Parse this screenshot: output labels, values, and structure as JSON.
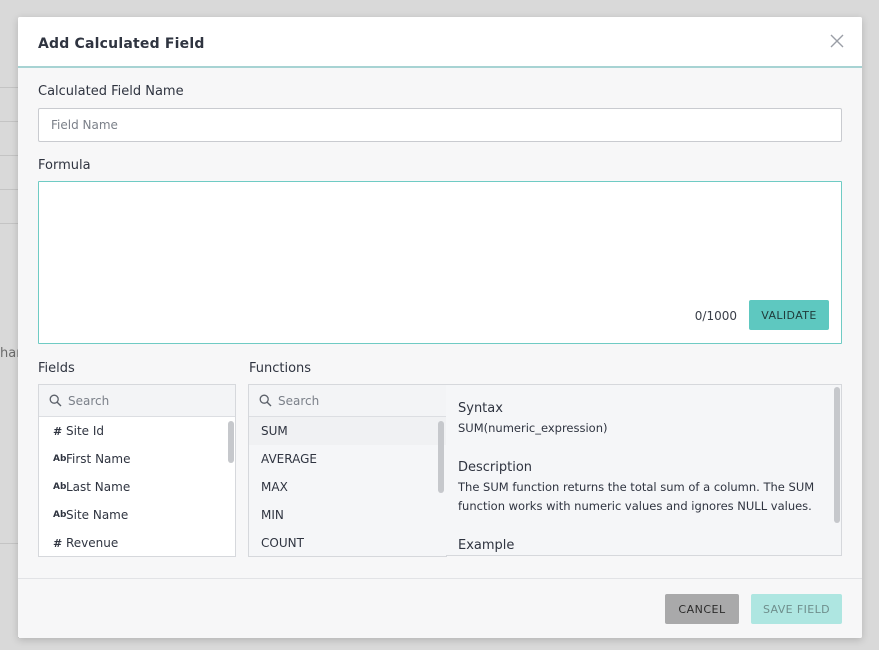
{
  "background": {
    "partial_text": "har"
  },
  "dialog": {
    "title": "Add Calculated Field",
    "close_icon": "close-icon",
    "name_field": {
      "label": "Calculated Field Name",
      "placeholder": "Field Name",
      "value": ""
    },
    "formula": {
      "label": "Formula",
      "value": "",
      "char_count": "0/1000",
      "validate_label": "VALIDATE"
    },
    "fields": {
      "label": "Fields",
      "search_placeholder": "Search",
      "items": [
        {
          "type_icon": "#",
          "type": "number-icon",
          "label": "Site Id"
        },
        {
          "type_icon": "Ab",
          "type": "text-icon",
          "label": "First Name"
        },
        {
          "type_icon": "Ab",
          "type": "text-icon",
          "label": "Last Name"
        },
        {
          "type_icon": "Ab",
          "type": "text-icon",
          "label": "Site Name"
        },
        {
          "type_icon": "#",
          "type": "number-icon",
          "label": "Revenue"
        }
      ]
    },
    "functions": {
      "label": "Functions",
      "search_placeholder": "Search",
      "items": [
        "SUM",
        "AVERAGE",
        "MAX",
        "MIN",
        "COUNT"
      ],
      "selected": "SUM"
    },
    "details": {
      "syntax_heading": "Syntax",
      "syntax": "SUM(numeric_expression)",
      "description_heading": "Description",
      "description": "The SUM function returns the total sum of a column. The SUM function works with numeric values and ignores NULL values.",
      "example_heading": "Example"
    },
    "footer": {
      "cancel_label": "CANCEL",
      "save_label": "SAVE FIELD"
    }
  },
  "colors": {
    "accent": "#5ec8c0",
    "accent_disabled": "#aee6e1",
    "header_border": "#a7d3d3",
    "cancel": "#a9a9aa"
  }
}
